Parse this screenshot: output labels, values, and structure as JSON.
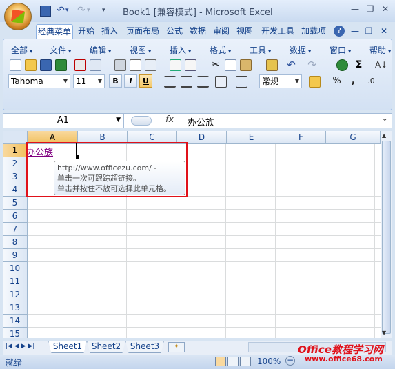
{
  "title": {
    "book": "Book1",
    "mode": "[兼容模式]",
    "sep": " - ",
    "app": "Microsoft Excel"
  },
  "tabs": [
    "经典菜单",
    "开始",
    "插入",
    "页面布局",
    "公式",
    "数据",
    "审阅",
    "视图",
    "开发工具",
    "加载项"
  ],
  "active_tab": "经典菜单",
  "menus": [
    "全部",
    "文件",
    "编辑",
    "视图",
    "插入",
    "格式",
    "工具",
    "数据",
    "窗口",
    "帮助"
  ],
  "font": {
    "name": "Tahoma",
    "size": "11"
  },
  "format_buttons": {
    "bold": "B",
    "italic": "I",
    "underline": "U"
  },
  "number_format": "常规",
  "percent": "%",
  "comma": ",",
  "formula_bar": {
    "name_box": "A1",
    "fx": "fx",
    "value": "办公族"
  },
  "columns": [
    "A",
    "B",
    "C",
    "D",
    "E",
    "F",
    "G"
  ],
  "rows": [
    "1",
    "2",
    "3",
    "4",
    "5",
    "6",
    "7",
    "8",
    "9",
    "10",
    "11",
    "12",
    "13",
    "14",
    "15"
  ],
  "cell_a1": "办公族",
  "tooltip": {
    "line1": "http://www.officezu.com/ -",
    "line2": "单击一次可跟踪超链接。",
    "line3": "单击并按住不放可选择此单元格。"
  },
  "sheets": [
    "Sheet1",
    "Sheet2",
    "Sheet3"
  ],
  "active_sheet": "Sheet1",
  "status": {
    "ready": "就绪",
    "zoom": "100%"
  },
  "watermark": {
    "line1": "Office教程学习网",
    "line2": "www.office68.com"
  },
  "colors": {
    "accent": "#15428b",
    "highlight": "#e0111a",
    "link": "#800080"
  }
}
